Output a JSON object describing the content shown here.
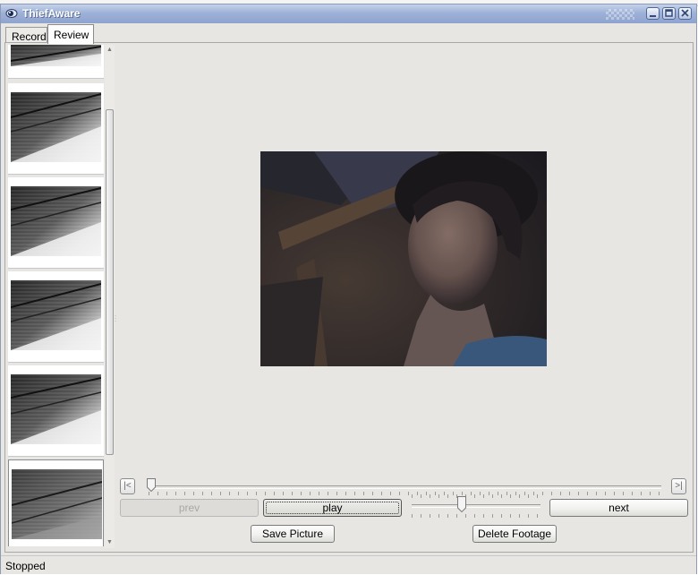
{
  "window": {
    "title": "ThiefAware",
    "title_color": "#9eb1d7"
  },
  "tabs": [
    {
      "label": "Record"
    },
    {
      "label": "Review",
      "active": true
    }
  ],
  "thumbnails": {
    "count": 6,
    "selected_index": 5
  },
  "viewer": {
    "description_icon": "webcam-frame"
  },
  "timeline": {
    "first_label": "|<",
    "last_label": ">|",
    "position": 0.0
  },
  "controls": {
    "prev_label": "prev",
    "play_label": "play",
    "next_label": "next",
    "save_label": "Save Picture",
    "delete_label": "Delete Footage",
    "speed_level": 0.38
  },
  "status": {
    "text": "Stopped"
  }
}
